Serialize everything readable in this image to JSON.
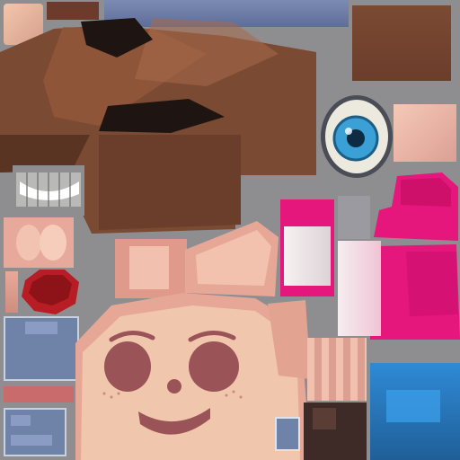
{
  "texture": {
    "kind": "character-texture-atlas",
    "palette": {
      "background": "#8e8e90",
      "hair_brown": "#7a4a32",
      "hair_shadow": "#5a3423",
      "skin_light": "#f0c9ad",
      "skin_mid": "#d99b86",
      "cheek": "#9a5458",
      "mouth_red": "#b81c24",
      "pink_magenta": "#e5167c",
      "pink_light": "#f3bfd0",
      "denim_blue": "#6f82a8",
      "bright_blue": "#2f8ad6",
      "iris_blue": "#3aa0d6",
      "dark_brown": "#3e2a26"
    },
    "icons": [
      "eye-icon",
      "teeth-icon",
      "face-icon",
      "ear-icon",
      "lips-icon",
      "clothing-icon"
    ]
  }
}
